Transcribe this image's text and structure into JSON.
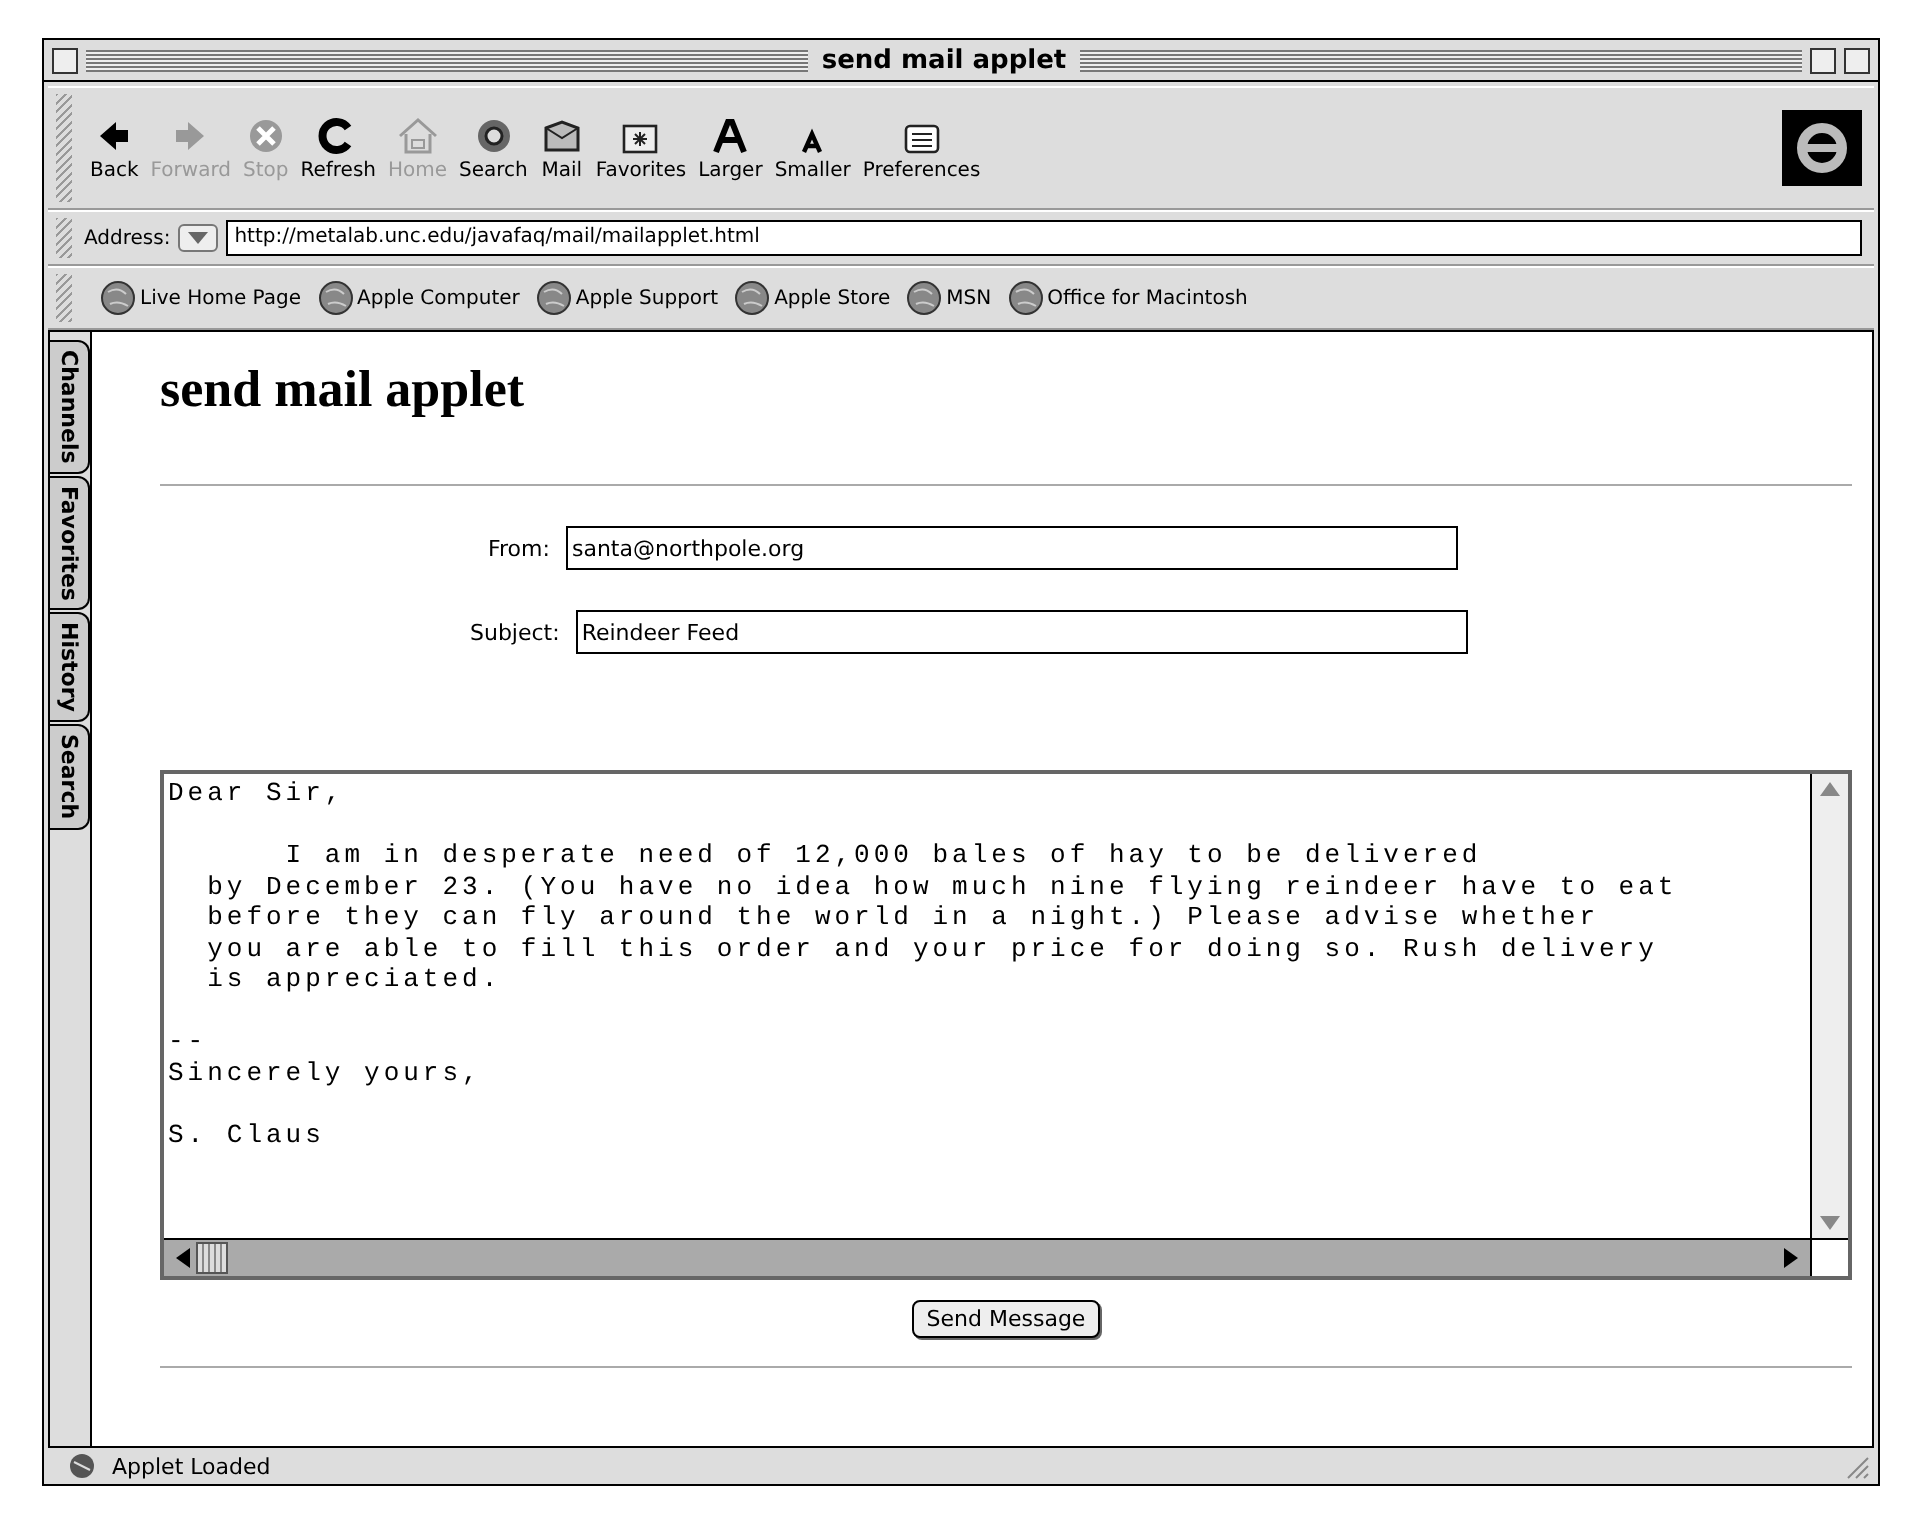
{
  "window": {
    "title": "send mail applet"
  },
  "toolbar": [
    {
      "label": "Back",
      "kind": "back",
      "disabled": false
    },
    {
      "label": "Forward",
      "kind": "forward",
      "disabled": true
    },
    {
      "label": "Stop",
      "kind": "stop",
      "disabled": true
    },
    {
      "label": "Refresh",
      "kind": "refresh",
      "disabled": false
    },
    {
      "label": "Home",
      "kind": "home",
      "disabled": true
    },
    {
      "label": "Search",
      "kind": "search",
      "disabled": false
    },
    {
      "label": "Mail",
      "kind": "mail",
      "disabled": false
    },
    {
      "label": "Favorites",
      "kind": "favorites",
      "disabled": false
    },
    {
      "label": "Larger",
      "kind": "larger",
      "disabled": false
    },
    {
      "label": "Smaller",
      "kind": "smaller",
      "disabled": false
    },
    {
      "label": "Preferences",
      "kind": "preferences",
      "disabled": false
    }
  ],
  "address": {
    "label": "Address:",
    "value": "http://metalab.unc.edu/javafaq/mail/mailapplet.html"
  },
  "favorites": [
    "Live Home Page",
    "Apple Computer",
    "Apple Support",
    "Apple Store",
    "MSN",
    "Office for Macintosh"
  ],
  "side_tabs": [
    "Channels",
    "Favorites",
    "History",
    "Search"
  ],
  "page": {
    "heading": "send mail applet",
    "fields": [
      {
        "label": "From:",
        "value": "santa@northpole.org"
      },
      {
        "label": "Subject:",
        "value": "Reindeer Feed"
      }
    ],
    "message_paragraphs": [
      [
        "Dear Sir,"
      ],
      [
        "      I am in desperate need of 12,000 bales of hay to be delivered",
        "  by December 23. (You have no idea how much nine flying reindeer have to eat",
        "  before they can fly around the world in a night.) Please advise whether",
        "  you are able to fill this order and your price for doing so. Rush delivery",
        "  is appreciated."
      ],
      [
        "--",
        "Sincerely yours,"
      ],
      [
        "S. Claus"
      ]
    ],
    "send_button": "Send Message"
  },
  "status_bar": {
    "text": "Applet Loaded"
  }
}
